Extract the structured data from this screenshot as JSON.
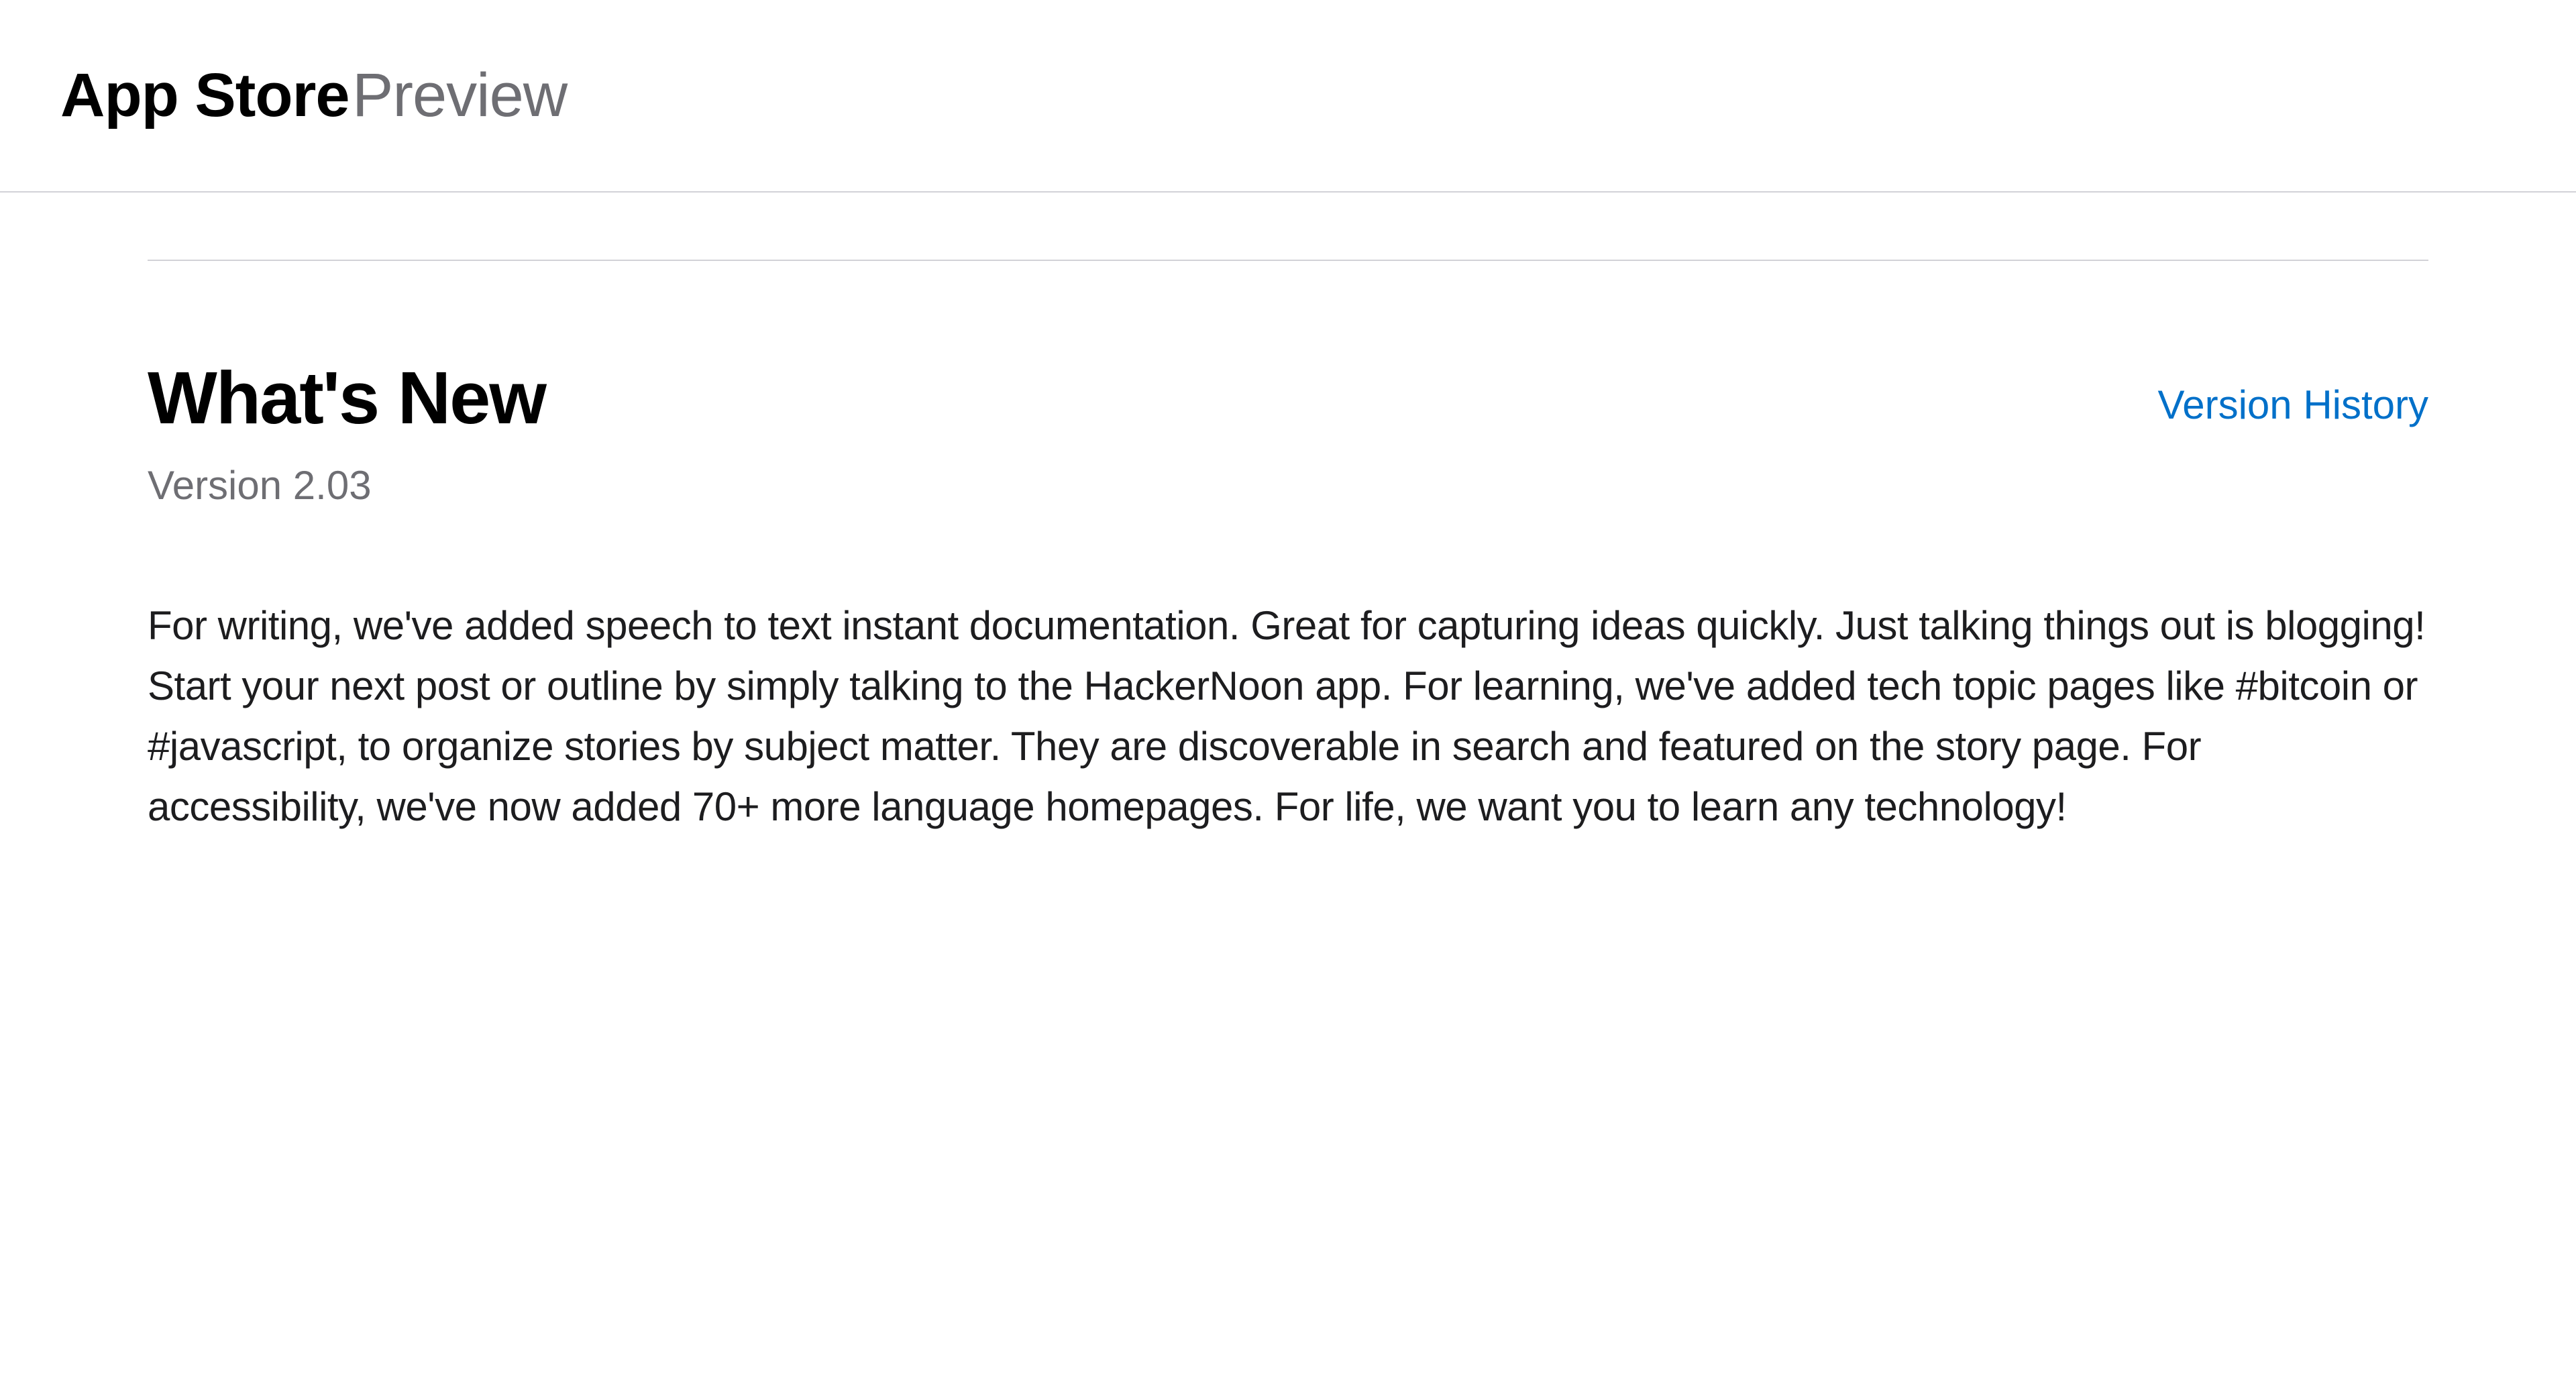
{
  "header": {
    "title_strong": "App Store",
    "title_light": "Preview"
  },
  "whats_new": {
    "heading": "What's New",
    "version_history_label": "Version History",
    "version_label": "Version 2.03",
    "release_notes": "For writing, we've added speech to text instant documentation. Great for capturing ideas quickly. Just talking things out is blogging! Start your next post or outline by simply talking to the HackerNoon app. For learning, we've added tech topic pages like #bitcoin or #javascript, to organize stories by subject matter. They are discoverable in search and featured on the story page. For accessibility, we've now added 70+ more language homepages. For life, we want you to learn any technology!"
  }
}
